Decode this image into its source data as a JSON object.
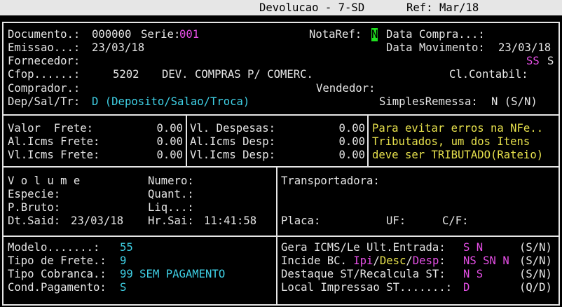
{
  "titlebar": {
    "program": "Devolucao - 7-SD",
    "ref": "Ref: Mar/18"
  },
  "header": {
    "documento_label": "Documento.:",
    "documento_value": "000000",
    "serie_label": "Serie:",
    "serie_value": "001",
    "notaref_label": "NotaRef:",
    "notaref_value": "N",
    "data_compra_label": "Data Compra...:",
    "emissao_label": "Emissao...:",
    "emissao_value": "23/03/18",
    "data_movimento_label": "Data Movimento:",
    "data_movimento_value": "23/03/18",
    "fornecedor_label": "Fornecedor:",
    "ss_value_1": "SS",
    "ss_value_2": "S",
    "cfop_label": "Cfop......:",
    "cfop_code": "5202",
    "cfop_desc": "DEV. COMPRAS P/ COMERC.",
    "cl_contabil_label": "Cl.Contabil:",
    "comprador_label": "Comprador.:",
    "vendedor_label": "Vendedor:",
    "dep_label": "Dep/Sal/Tr:",
    "dep_value": "D (Deposito/Salao/Troca)",
    "simples_label": "SimplesRemessa:",
    "simples_value": "N (S/N)"
  },
  "valores": {
    "valor_frete_label": "Valor  Frete:",
    "valor_frete": "0.00",
    "al_icms_frete_label": "Al.Icms Frete:",
    "al_icms_frete": "0.00",
    "vl_icms_frete_label": "Vl.Icms Frete:",
    "vl_icms_frete": "0.00",
    "vl_despesas_label": "Vl. Despesas:",
    "vl_despesas": "0.00",
    "al_icms_desp_label": "Al.Icms Desp:",
    "al_icms_desp": "0.00",
    "vl_icms_desp_label": "Vl.Icms Desp:",
    "vl_icms_desp": "0.00",
    "aviso_1": "Para evitar erros na NFe..",
    "aviso_2": "Tributados, um dos Itens",
    "aviso_3": "deve ser TRIBUTADO(Rateio)"
  },
  "volume": {
    "volume_label": "V o l u m e",
    "numero_label": "Numero:",
    "especie_label": "Especie:",
    "quant_label": "Quant.:",
    "pbruto_label": "P.Bruto:",
    "liq_label": "Liq...:",
    "dt_said_label": "Dt.Said:",
    "dt_said_value": "23/03/18",
    "hr_sai_label": "Hr.Sai:",
    "hr_sai_value": "11:41:58",
    "transportadora_label": "Transportadora:",
    "placa_label": "Placa:",
    "uf_label": "UF:",
    "cf_label": "C/F:"
  },
  "rodape": {
    "modelo_label": "Modelo.......:",
    "modelo_value": "55",
    "tipo_frete_label": "Tipo de Frete.:",
    "tipo_frete_value": "9",
    "tipo_cobranca_label": "Tipo Cobranca.:",
    "tipo_cobranca_value": "99 SEM PAGAMENTO",
    "cond_pag_label": "Cond.Pagamento:",
    "cond_pag_value": "S",
    "gera_icms_label": "Gera ICMS/Le Ult.Entrada:",
    "gera_icms_value": "S N",
    "gera_icms_opt": "(S/N)",
    "incide_label_1": "Incide BC. ",
    "incide_ipi": "Ipi",
    "incide_slash1": "/",
    "incide_desc": "Desc",
    "incide_slash2": "/",
    "incide_desp": "Desp",
    "incide_colon": ":",
    "incide_value": "NS SN N",
    "incide_opt": "(S/N)",
    "destaque_label": "Destaque ST/Recalcula ST:",
    "destaque_value": "N S",
    "destaque_opt": "(S/N)",
    "local_label": "Local Impressao ST.......:",
    "local_value": "D",
    "local_opt": "(Q/D)"
  }
}
